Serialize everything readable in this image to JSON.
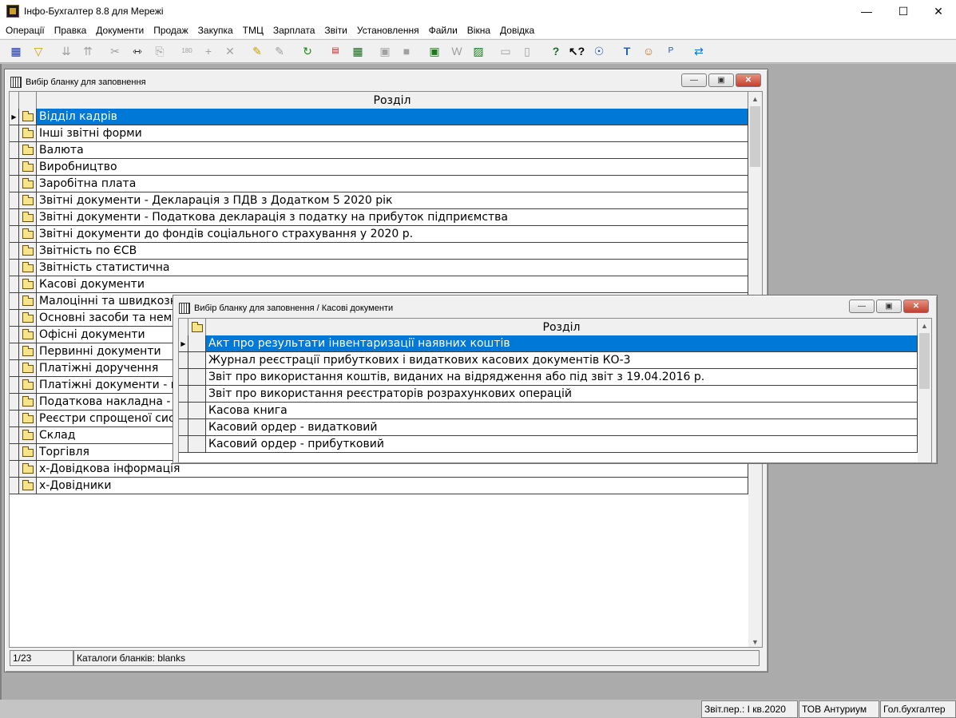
{
  "app": {
    "title": "Інфо-Бухгалтер 8.8 для Мережі"
  },
  "menu": [
    "Операції",
    "Правка",
    "Документи",
    "Продаж",
    "Закупка",
    "ТМЦ",
    "Зарплата",
    "Звіти",
    "Установлення",
    "Файли",
    "Вікна",
    "Довідка"
  ],
  "toolbar_icons": [
    "grid-icon",
    "filter-icon",
    "sort-asc-icon",
    "sort-desc-icon",
    "cut-icon",
    "split-icon",
    "copy-icon",
    "rotate-180-icon",
    "add-icon",
    "delete-icon",
    "marker-icon",
    "print-marker-icon",
    "refresh-icon",
    "pdf-icon",
    "calculator-icon",
    "open-folder-icon",
    "save-icon",
    "excel-icon",
    "word-icon",
    "export-icon",
    "printer-icon",
    "preview-icon",
    "help-icon",
    "context-help-icon",
    "compass-icon",
    "text-icon",
    "users-icon",
    "report-icon",
    "teamviewer-icon"
  ],
  "main_window": {
    "title": "Вибір бланку для заповнення",
    "column_header": "Розділ",
    "rows": [
      "Відділ кадрів",
      "Інші звітні форми",
      "Валюта",
      "Виробництво",
      "Заробітна плата",
      "Звітні документи - Декларація з ПДВ з Додатком 5  2020 рік",
      "Звітні документи - Податкова декларація з податку на прибуток підприємства",
      "Звітні документи до фондів соціального страхування у 2020 р.",
      "Звітність по ЄСВ",
      "Звітність статистична",
      "Касові документи",
      "Малоцінні та швидкозношувані предмети",
      "Основні засоби та нематеріальні активи",
      "Офісні документи",
      "Первинні документи",
      "Платіжні доручення",
      "Платіжні документи - валютні",
      "Податкова накладна - Додаток",
      "Реєстри спрощеної системи",
      "Склад",
      "Торгівля",
      "х-Довідкова інформація",
      "х-Довідники"
    ],
    "status_position": "1/23",
    "status_catalog": "Каталоги бланків: blanks"
  },
  "sub_window": {
    "title": "Вибір бланку для заповнення / Касові документи",
    "column_header": "Розділ",
    "rows": [
      "Акт про результати інвентаризації наявних коштів",
      "Журнал реєстрації прибуткових і видаткових касових документів КО-3",
      "Звіт про використання коштів, виданих на відрядження або під звіт з 19.04.2016 р.",
      "Звіт про використання реєстраторів розрахункових операцій",
      "Касова книга",
      "Касовий ордер - видатковий",
      "Касовий ордер - прибутковий"
    ]
  },
  "status_bar": {
    "period": "Звіт.пер.: I кв.2020",
    "company": "ТОВ Антуриум",
    "user": "Гол.бухгалтер"
  }
}
